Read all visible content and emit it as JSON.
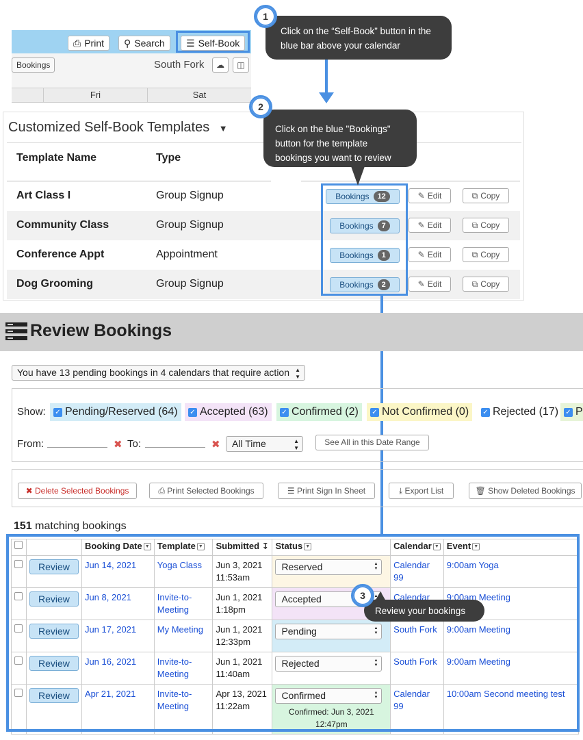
{
  "toolbar": {
    "print_label": "Print",
    "search_label": "Search",
    "selfbook_label": "Self-Book",
    "bookings_label": "Bookings",
    "calendar_name": "South Fork",
    "days": [
      "Fri",
      "Sat"
    ]
  },
  "callouts": [
    {
      "num": "1",
      "text": "Click on the “Self-Book” button in the blue bar above your calendar"
    },
    {
      "num": "2",
      "text": "Click on the blue \"Bookings\" button for the template bookings you want to review"
    },
    {
      "num": "3",
      "text": "Review your bookings"
    }
  ],
  "templates": {
    "title": "Customized Self-Book Templates",
    "col_name": "Template Name",
    "col_type": "Type",
    "bookings_label": "Bookings",
    "edit_label": "Edit",
    "copy_label": "Copy",
    "rows": [
      {
        "name": "Art Class I",
        "type": "Group Signup",
        "count": "12"
      },
      {
        "name": "Community Class",
        "type": "Group Signup",
        "count": "7"
      },
      {
        "name": "Conference Appt",
        "type": "Appointment",
        "count": "1"
      },
      {
        "name": "Dog Grooming",
        "type": "Group Signup",
        "count": "2"
      }
    ]
  },
  "review": {
    "title": "Review Bookings",
    "pending_text": "You have 13 pending bookings in 4 calendars that require action",
    "show_label": "Show:",
    "filters": [
      {
        "label": "Pending/Reserved (64)",
        "color": "#d3ecf7"
      },
      {
        "label": "Accepted (63)",
        "color": "#f3e3f7"
      },
      {
        "label": "Confirmed (2)",
        "color": "#d7f5df"
      },
      {
        "label": "Not Confirmed (0)",
        "color": "#fbf6c6"
      },
      {
        "label": "Rejected (17)",
        "color": "#ffffff"
      },
      {
        "label": "Pa",
        "color": "#e7f4d8"
      }
    ],
    "from_label": "From:",
    "to_label": "To:",
    "range_value": "All Time",
    "see_all_label": "See All in this Date Range",
    "actions": {
      "delete": "Delete Selected Bookings",
      "print": "Print Selected Bookings",
      "signin": "Print Sign In Sheet",
      "export": "Export List",
      "show_deleted": "Show Deleted Bookings"
    },
    "match_count": "151",
    "match_label": "matching bookings",
    "columns": [
      "Booking Date",
      "Template",
      "Submitted",
      "Status",
      "Calendar",
      "Event"
    ],
    "review_label": "Review",
    "rows": [
      {
        "date": "Jun 14, 2021",
        "template": "Yoga Class",
        "submitted": "Jun 3, 2021 11:53am",
        "status": "Reserved",
        "status_color": "#fdf6e4",
        "calendar": "Calendar 99",
        "event": "9:00am Yoga",
        "note": ""
      },
      {
        "date": "Jun 8, 2021",
        "template": "Invite-to-Meeting",
        "submitted": "Jun 1, 2021 1:18pm",
        "status": "Accepted",
        "status_color": "#f3e3f7",
        "calendar": "Calendar",
        "event": "9:00am Meeting",
        "note": ""
      },
      {
        "date": "Jun 17, 2021",
        "template": "My Meeting",
        "submitted": "Jun 1, 2021 12:33pm",
        "status": "Pending",
        "status_color": "#d3ecf7",
        "calendar": "South Fork",
        "event": "9:00am Meeting",
        "note": ""
      },
      {
        "date": "Jun 16, 2021",
        "template": "Invite-to-Meeting",
        "submitted": "Jun 1, 2021 11:40am",
        "status": "Rejected",
        "status_color": "#ffffff",
        "calendar": "South Fork",
        "event": "9:00am Meeting",
        "note": ""
      },
      {
        "date": "Apr 21, 2021",
        "template": "Invite-to-Meeting",
        "submitted": "Apr 13, 2021 11:22am",
        "status": "Confirmed",
        "status_color": "#d7f5df",
        "calendar": "Calendar 99",
        "event": "10:00am Second meeting test",
        "note": "Confirmed: Jun 3, 2021 12:47pm"
      }
    ]
  },
  "colors": {
    "highlight": "#4a90e2",
    "callout_bg": "#3d3d3d",
    "bar_blue": "#9fd3f2"
  }
}
